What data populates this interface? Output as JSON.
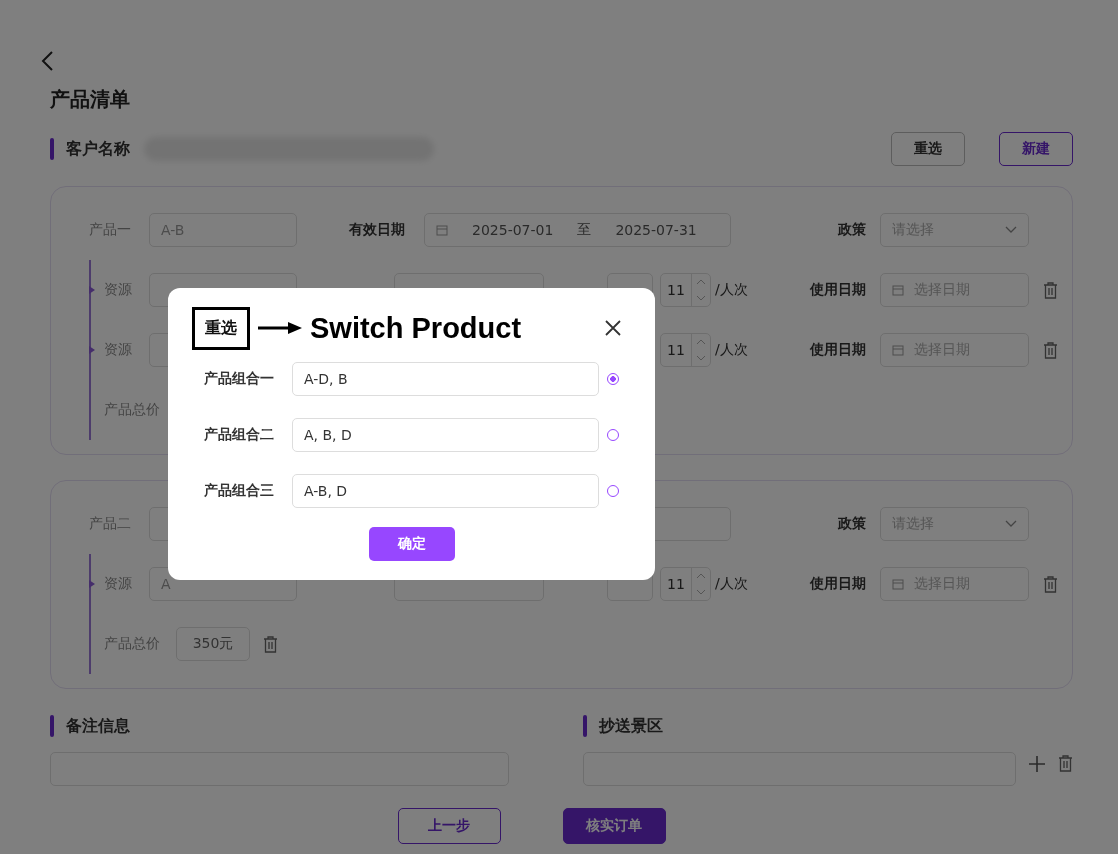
{
  "page_title": "产品清单",
  "customer": {
    "label": "客户名称",
    "buttons": [
      {
        "label": "重选",
        "kind": "default"
      },
      {
        "label": "新建",
        "kind": "outline"
      }
    ]
  },
  "products": [
    {
      "name_label": "产品一",
      "name_value": "A-B",
      "date_label": "有效日期",
      "date_from": "2025-07-01",
      "date_sep": "至",
      "date_to": "2025-07-31",
      "policy_label": "政策",
      "policy_placeholder": "请选择",
      "resources": [
        {
          "label": "资源",
          "quantity": "11",
          "unit": "/人次",
          "use_date_label": "使用日期",
          "use_date_placeholder": "选择日期"
        },
        {
          "label": "资源",
          "quantity": "11",
          "unit": "/人次",
          "use_date_label": "使用日期",
          "use_date_placeholder": "选择日期"
        }
      ],
      "total_label": "产品总价"
    },
    {
      "name_label": "产品二",
      "policy_label": "政策",
      "policy_placeholder": "请选择",
      "resources": [
        {
          "label": "资源",
          "value": "A",
          "quantity": "11",
          "unit": "/人次",
          "use_date_label": "使用日期",
          "use_date_placeholder": "选择日期"
        }
      ],
      "total_label": "产品总价",
      "total_value": "350元"
    }
  ],
  "remarks": {
    "label": "备注信息"
  },
  "cc": {
    "label": "抄送景区"
  },
  "footer_buttons": [
    {
      "label": "上一步",
      "kind": "outline"
    },
    {
      "label": "核实订单",
      "kind": "primary"
    }
  ],
  "modal": {
    "tag": "重选",
    "title": "Switch Product",
    "options": [
      {
        "label": "产品组合一",
        "value": "A-D, B",
        "selected": true
      },
      {
        "label": "产品组合二",
        "value": "A, B, D",
        "selected": false
      },
      {
        "label": "产品组合三",
        "value": "A-B, D",
        "selected": false
      }
    ],
    "confirm": "确定"
  }
}
